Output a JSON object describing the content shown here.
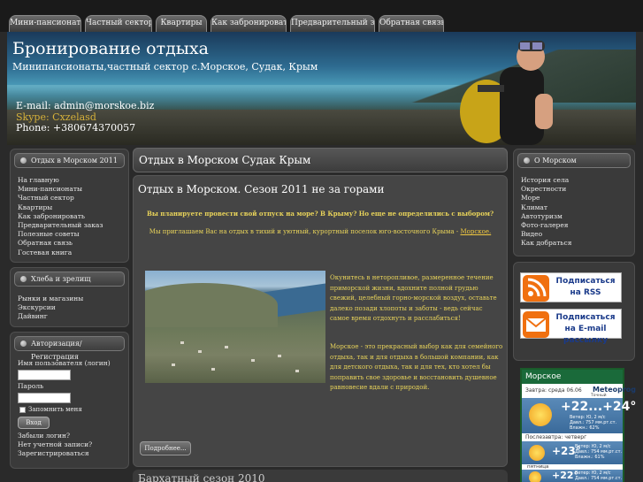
{
  "nav": {
    "tabs": [
      "Мини-пансионаты",
      "Частный сектор",
      "Квартиры",
      "Как забронировать",
      "Предварительный заказ",
      "Обратная связь"
    ]
  },
  "header": {
    "title": "Бронирование отдыха",
    "subtitle": "Минипансионаты,частный сектор с.Морское, Судак, Крым",
    "email": "E-mail: admin@morskoe.biz",
    "skype": "Skype: Cxzelasd",
    "phone": "Phone: +380674370057"
  },
  "left": {
    "box1_title": "Отдых в Морском 2011",
    "box1_items": [
      "На главную",
      "Мини-пансионаты",
      "Частный сектор",
      "Квартиры",
      "Как забронировать",
      "Предварительный заказ",
      "Полезные советы",
      "Обратная связь",
      "Гостевая книга"
    ],
    "box2_title": "Хлеба и зрелищ",
    "box2_items": [
      "Рынки и магазины",
      "Экскурсии",
      "Дайвинг"
    ],
    "box3_title": "Авторизация/Регистрация",
    "login_label": "Имя пользователя (логин)",
    "password_label": "Пароль",
    "remember_label": "Запомнить меня",
    "login_button": "Вход",
    "forgot_login": "Забыли логин?",
    "no_account": "Нет учетной записи?",
    "register": "Зарегистрироваться"
  },
  "main": {
    "heading": "Отдых в Морском Судак Крым",
    "article_title": "Отдых в Морском. Сезон 2011 не за горами",
    "question": "Вы планируете провести свой отпуск на море? В Крыму? Но еще не определились с выбором?",
    "invite": "Мы приглашаем Вас на отдых в тихий и уютный, курортный поселок юго-восточного Крыма -",
    "invite_link": "Морское.",
    "para1": "Окунитесь в неторопливое, размеренное течение приморской жизни, вдохните полной грудью свежий, целебный горно-морской воздух, оставьте далеко позади хлопоты и заботы - ведь сейчас самое время отдохнуть и расслабиться!",
    "para2": "Морское - это прекрасный выбор как для семейного отдыха, так и для отдыха в большой компании, как для детского отдыха, так и для тех, кто хотел бы поправить свое здоровье и восстановить душевное равновесие вдали с природой.",
    "more_button": "Подробнее...",
    "next_heading": "Бархатный сезон 2010"
  },
  "right": {
    "box_title": "О Морском",
    "items": [
      "История села",
      "Окрестности",
      "Море",
      "Климат",
      "Автотуризм",
      "Фото-галерея",
      "Видео",
      "Как добраться"
    ],
    "rss_label": "Подписаться на RSS",
    "email_label": "Подписаться на E-mail рассылку"
  },
  "weather": {
    "city": "Морское",
    "brand": "Meteoprog",
    "brand_sub": "Точный прогноз",
    "today_label": "Завтра: среда 06.06",
    "today_temp": "+22...+24°",
    "today_wind": "Ветер: Ю, 2 м/с",
    "today_press": "Давл.: 757 мм.рт.ст.",
    "today_hum": "Влажн.: 62%",
    "day2_label": "Послезавтра: четверг",
    "day2_temp": "+23°",
    "day2_wind": "Ветер: Ю, 2 м/с",
    "day2_press": "Давл.: 754 мм.рт.ст.",
    "day2_hum": "Влажн.: 61%",
    "day2_name": "пятница",
    "day3_temp": "+22°",
    "day3_wind": "Ветер: Ю, 2 м/с",
    "day3_press": "Давл.: 754 мм.рт.ст."
  }
}
